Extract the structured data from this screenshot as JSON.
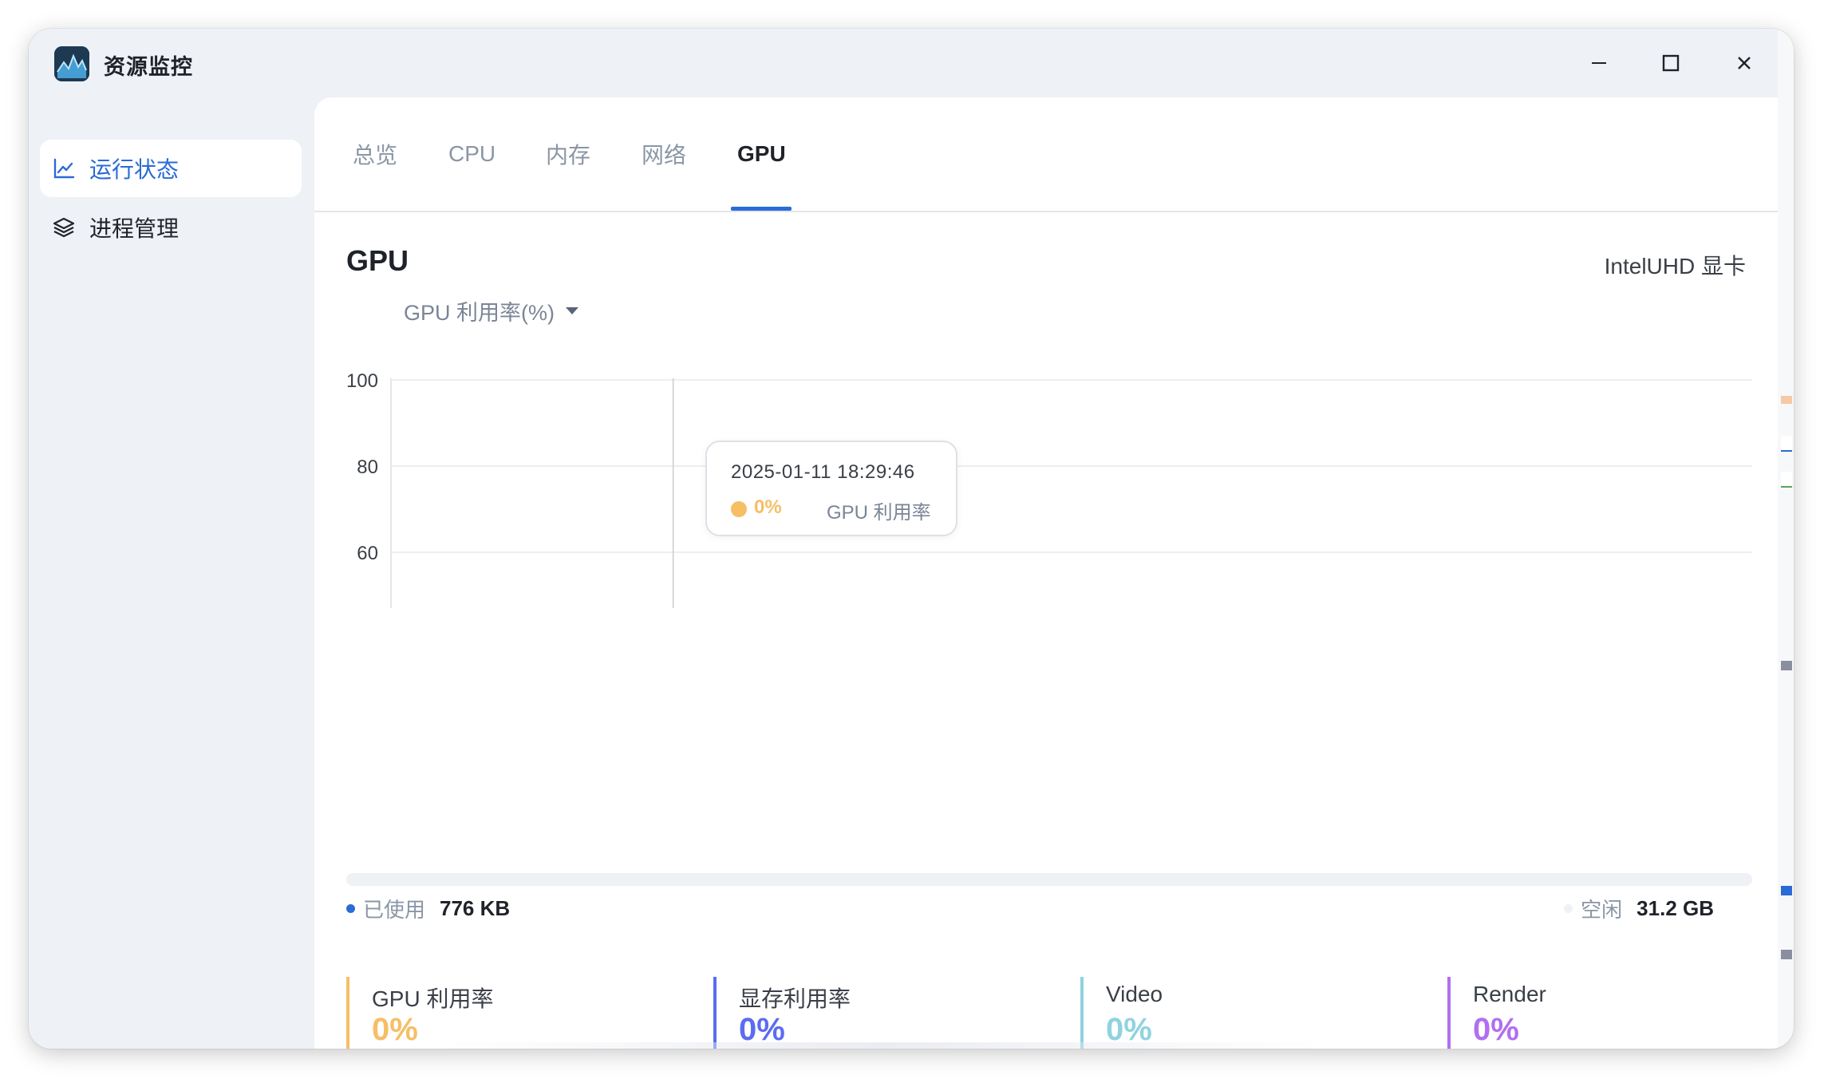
{
  "app": {
    "title": "资源监控"
  },
  "window_controls": {
    "minimize": "minimize-icon",
    "maximize": "maximize-icon",
    "close": "close-icon"
  },
  "sidebar": {
    "items": [
      {
        "label": "运行状态",
        "icon": "line-chart-icon",
        "active": true
      },
      {
        "label": "进程管理",
        "icon": "layers-icon",
        "active": false
      }
    ]
  },
  "tabs": [
    {
      "label": "总览",
      "active": false
    },
    {
      "label": "CPU",
      "active": false
    },
    {
      "label": "内存",
      "active": false
    },
    {
      "label": "网络",
      "active": false
    },
    {
      "label": "GPU",
      "active": true
    }
  ],
  "gpu": {
    "heading": "GPU",
    "card_name": "IntelUHD 显卡",
    "metric_selector": "GPU 利用率(%)"
  },
  "tooltip": {
    "time": "2025-01-11 18:29:46",
    "value": "0%",
    "series": "GPU 利用率"
  },
  "memory": {
    "used_label": "已使用",
    "used_value": "776 KB",
    "free_label": "空闲",
    "free_value": "31.2 GB",
    "used_fraction": 2e-05
  },
  "stats": [
    {
      "label": "GPU 利用率",
      "value": "0%",
      "color": "#f6be65"
    },
    {
      "label": "显存利用率",
      "value": "0%",
      "color": "#5b6cf0"
    },
    {
      "label": "Video",
      "value": "0%",
      "color": "#8fd3df"
    },
    {
      "label": "Render",
      "value": "0%",
      "color": "#b16ff0"
    }
  ],
  "colors": {
    "accent": "#2a6bd6",
    "series": "#f6be65"
  },
  "chart_data": {
    "type": "line",
    "y_ticks": [
      "100",
      "80",
      "60",
      "40",
      "20"
    ],
    "ylim": [
      0,
      100
    ],
    "grid": true,
    "series": [
      {
        "name": "GPU 利用率",
        "color": "#f6be65",
        "values": [
          0,
          0,
          0,
          0,
          0,
          0,
          0,
          0,
          0,
          0,
          0,
          0,
          0,
          0,
          0,
          0,
          0,
          0,
          0,
          0,
          0,
          0,
          0,
          0,
          0,
          0,
          0,
          0,
          0,
          0,
          0,
          0,
          0,
          0,
          0,
          0,
          0,
          0,
          0,
          0,
          0,
          0,
          0,
          0,
          0,
          0,
          0,
          0,
          0,
          0
        ]
      }
    ],
    "highlight_index": 5
  }
}
